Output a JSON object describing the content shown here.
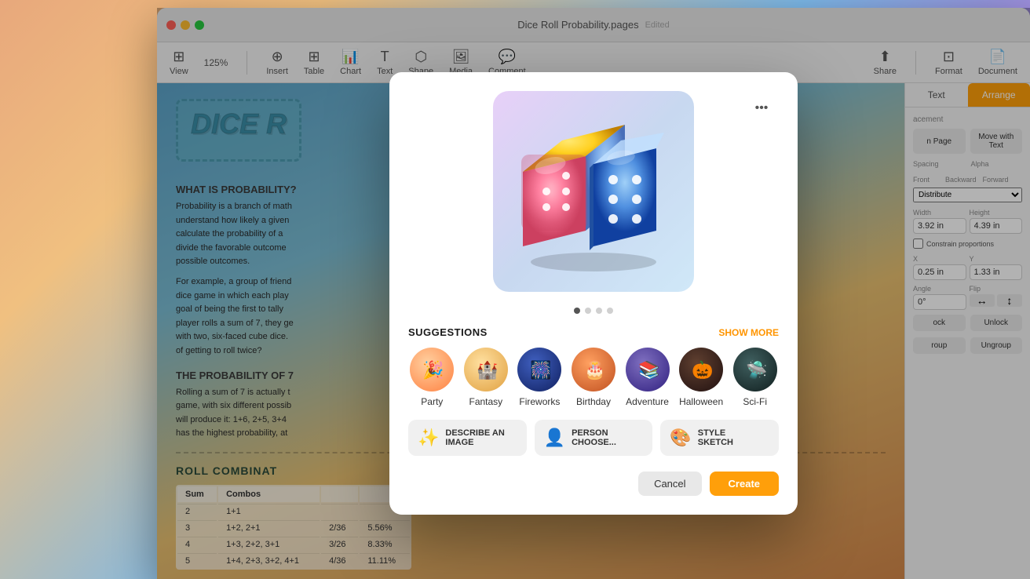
{
  "window": {
    "title": "Dice Roll Probability.pages",
    "subtitle": "Edited"
  },
  "toolbar": {
    "view_label": "View",
    "zoom_label": "125%",
    "insert_label": "Insert",
    "table_label": "Table",
    "chart_label": "Chart",
    "text_label": "Text",
    "shape_label": "Shape",
    "media_label": "Media",
    "comment_label": "Comment",
    "share_label": "Share",
    "format_label": "Format",
    "document_label": "Document"
  },
  "right_panel": {
    "tab_text": "Text",
    "tab_arrange": "Arrange",
    "placement_label": "acement",
    "on_page_btn": "n Page",
    "move_with_text_btn": "Move with Text",
    "spacing_label": "Spacing",
    "alpha_label": "Alpha",
    "width_label": "Width",
    "height_label": "Height",
    "width_value": "3.92 in",
    "height_value": "4.39 in",
    "constrain_label": "Constrain proportions",
    "x_label": "X",
    "y_label": "Y",
    "x_value": "0.25 in",
    "y_value": "1.33 in",
    "angle_label": "Angle",
    "flip_label": "Flip",
    "angle_value": "0°",
    "lock_btn": "ock",
    "unlock_btn": "Unlock",
    "group_btn": "roup",
    "ungroup_btn": "Ungroup",
    "front_label": "Front",
    "backward_label": "Backward",
    "forward_label": "Forward",
    "distribute_label": "Distribute"
  },
  "document": {
    "title": "DICE R",
    "what_is_title": "WHAT IS PROBABILITY?",
    "what_is_text": "Probability is a branch of math\nunderstand how likely a given\ncalculate the probability of a\ndivide the favorable outcome\npossible outcomes.",
    "example_text": "For example, a group of friend\ndice game in which each play\ngoal of being the first to tally\nplayer rolls a sum of 7, they ge\nwith two, six-faced cube dice.\nof getting to roll twice?",
    "prob7_title": "THE PROBABILITY OF 7",
    "prob7_text": "Rolling a sum of 7 is actually t\ngame, with six different possib\nwill produce it: 1+6, 2+5, 3+4\nhas the highest probability, at",
    "combos_title": "ROLL COMBINAT",
    "table_headers": [
      "Sum",
      "Combos",
      "",
      ""
    ],
    "table_rows": [
      [
        "2",
        "1+1",
        "",
        ""
      ],
      [
        "3",
        "1+2, 2+1",
        "2/36",
        "5.56%"
      ],
      [
        "4",
        "1+3, 2+2, 3+1",
        "3/26",
        "8.33%"
      ],
      [
        "5",
        "1+4, 2+3, 3+2, 4+1",
        "4/36",
        "11.11%"
      ]
    ]
  },
  "modal": {
    "more_btn_label": "•••",
    "dots": [
      true,
      false,
      false,
      false
    ],
    "suggestions_title": "SUGGESTIONS",
    "show_more_label": "SHOW MORE",
    "suggestions": [
      {
        "id": "party",
        "label": "Party",
        "emoji": "🎉",
        "bg": "#f8d0a0"
      },
      {
        "id": "fantasy",
        "label": "Fantasy",
        "emoji": "🏰",
        "bg": "#f0c880"
      },
      {
        "id": "fireworks",
        "label": "Fireworks",
        "emoji": "🎆",
        "bg": "#2040a0"
      },
      {
        "id": "birthday",
        "label": "Birthday",
        "emoji": "🎂",
        "bg": "#e08030"
      },
      {
        "id": "adventure",
        "label": "Adventure",
        "emoji": "📚",
        "bg": "#5040a8"
      },
      {
        "id": "halloween",
        "label": "Halloween",
        "emoji": "🎃",
        "bg": "#302020"
      },
      {
        "id": "sci-fi",
        "label": "Sci-Fi",
        "emoji": "🛸",
        "bg": "#204040"
      }
    ],
    "options": [
      {
        "id": "describe",
        "icon": "✨",
        "line1": "DESCRIBE AN",
        "line2": "IMAGE",
        "bg": "#f0f0f0"
      },
      {
        "id": "person",
        "icon": "👤",
        "line1": "PERSON",
        "line2": "CHOOSE...",
        "bg": "#f0f0f0"
      },
      {
        "id": "style",
        "icon": "🎨",
        "line1": "STYLE",
        "line2": "SKETCH",
        "bg": "#f0f0f0"
      }
    ],
    "cancel_label": "Cancel",
    "create_label": "Create"
  },
  "colors": {
    "orange_accent": "#ff9f0a",
    "create_btn": "#ff9f0a",
    "bg_gradient_start": "#e8a87c",
    "bg_gradient_end": "#7cb8e8"
  }
}
